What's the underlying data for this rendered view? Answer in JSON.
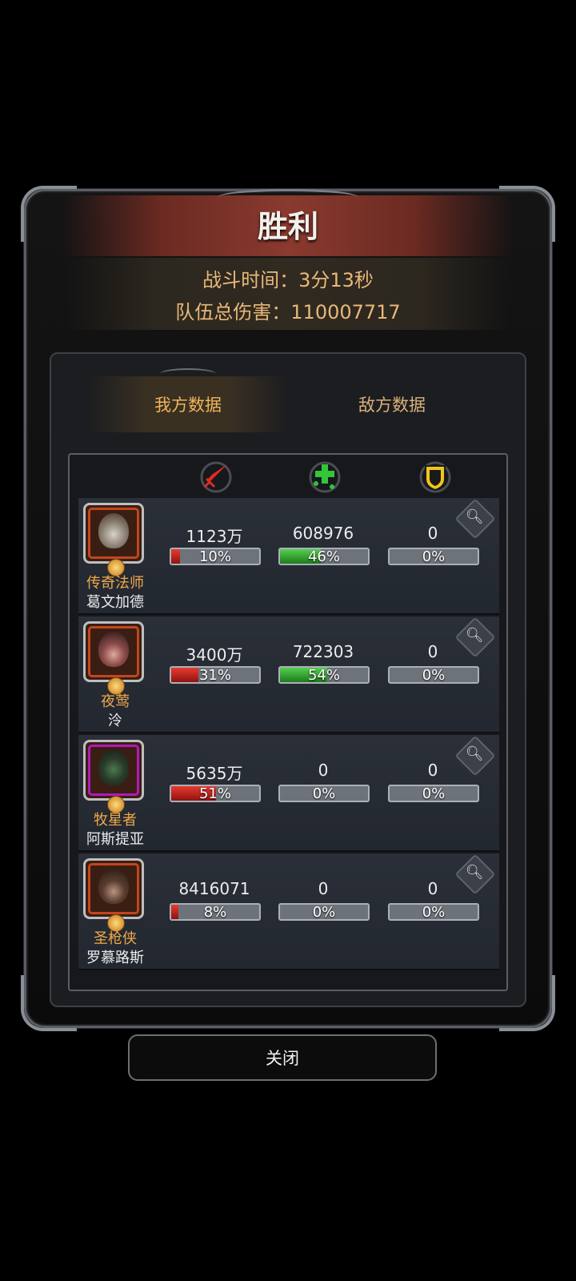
{
  "title": "胜利",
  "summary": {
    "battle_time": "战斗时间：3分13秒",
    "team_damage": "队伍总伤害：110007717"
  },
  "tabs": [
    {
      "label": "我方数据",
      "active": true
    },
    {
      "label": "敌方数据",
      "active": false
    }
  ],
  "columns": [
    {
      "icon": "sword-icon",
      "color": "#e02a22"
    },
    {
      "icon": "heal-cross-icon",
      "color": "#34c63a"
    },
    {
      "icon": "shield-icon",
      "color": "#f0c71a"
    }
  ],
  "heroes": [
    {
      "class": "传奇法师",
      "name": "葛文加德",
      "frame": "orange",
      "damage": "1123万",
      "damage_pct": "10%",
      "damage_frac": 0.1,
      "heal": "608976",
      "heal_pct": "46%",
      "heal_frac": 0.46,
      "tank": "0",
      "tank_pct": "0%",
      "tank_frac": 0
    },
    {
      "class": "夜莺",
      "name": "泠",
      "frame": "orange",
      "damage": "3400万",
      "damage_pct": "31%",
      "damage_frac": 0.31,
      "heal": "722303",
      "heal_pct": "54%",
      "heal_frac": 0.54,
      "tank": "0",
      "tank_pct": "0%",
      "tank_frac": 0
    },
    {
      "class": "牧星者",
      "name": "阿斯提亚",
      "frame": "purple",
      "damage": "5635万",
      "damage_pct": "51%",
      "damage_frac": 0.51,
      "heal": "0",
      "heal_pct": "0%",
      "heal_frac": 0,
      "tank": "0",
      "tank_pct": "0%",
      "tank_frac": 0
    },
    {
      "class": "圣枪侠",
      "name": "罗慕路斯",
      "frame": "orange",
      "damage": "8416071",
      "damage_pct": "8%",
      "damage_frac": 0.08,
      "heal": "0",
      "heal_pct": "0%",
      "heal_frac": 0,
      "tank": "0",
      "tank_pct": "0%",
      "tank_frac": 0
    }
  ],
  "close_label": "关闭"
}
